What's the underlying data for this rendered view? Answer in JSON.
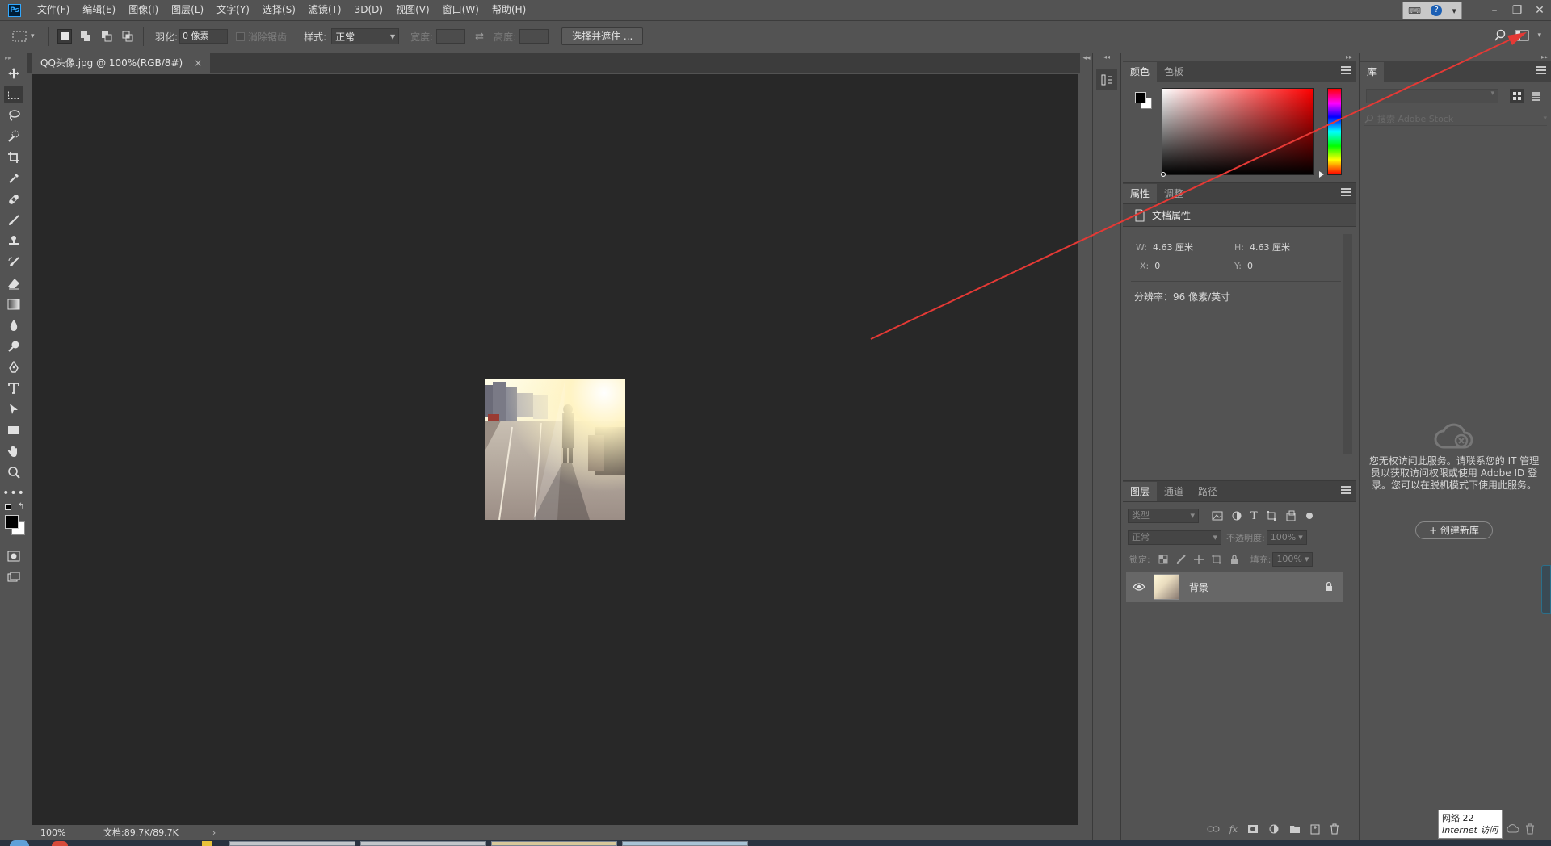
{
  "app": {
    "name": "Adobe Photoshop CC",
    "logo_text": "Ps"
  },
  "menu": [
    "文件(F)",
    "编辑(E)",
    "图像(I)",
    "图层(L)",
    "文字(Y)",
    "选择(S)",
    "滤镜(T)",
    "3D(D)",
    "视图(V)",
    "窗口(W)",
    "帮助(H)"
  ],
  "options": {
    "feather_label": "羽化:",
    "feather_value": "0 像素",
    "antialias_label": "消除锯齿",
    "style_label": "样式:",
    "style_value": "正常",
    "width_label": "宽度:",
    "height_label": "高度:",
    "select_mask_button": "选择并遮住 ..."
  },
  "document": {
    "tab_title": "QQ头像.jpg @ 100%(RGB/8#)",
    "close_glyph": "×"
  },
  "status": {
    "zoom": "100%",
    "doc_info": "文档:89.7K/89.7K",
    "arrow": "›"
  },
  "color_panel": {
    "tabs": [
      "颜色",
      "色板"
    ],
    "foreground": "#000000",
    "background": "#ffffff"
  },
  "properties_panel": {
    "tabs": [
      "属性",
      "调整"
    ],
    "section_title": "文档属性",
    "w_label": "W:",
    "w_value": "4.63 厘米",
    "h_label": "H:",
    "h_value": "4.63 厘米",
    "x_label": "X:",
    "x_value": "0",
    "y_label": "Y:",
    "y_value": "0",
    "resolution": "分辨率：96 像素/英寸"
  },
  "layers_panel": {
    "tabs": [
      "图层",
      "通道",
      "路径"
    ],
    "filter_placeholder": "类型",
    "blend_mode": "正常",
    "opacity_label": "不透明度:",
    "opacity_value": "100%",
    "lock_label": "锁定:",
    "fill_label": "填充:",
    "fill_value": "100%",
    "layers": [
      {
        "name": "背景",
        "visible": true,
        "locked": true
      }
    ]
  },
  "library_panel": {
    "tab": "库",
    "search_placeholder": "搜索 Adobe Stock",
    "message": "您无权访问此服务。请联系您的 IT 管理员以获取访问权限或使用 Adobe ID 登录。您可以在脱机模式下使用此服务。",
    "create_button": "+ 创建新库"
  },
  "network_tooltip": {
    "line1": "网络  22",
    "line2": "Internet 访问"
  },
  "colors": {
    "annotation": "#e53935",
    "accent": "#31a8ff"
  }
}
